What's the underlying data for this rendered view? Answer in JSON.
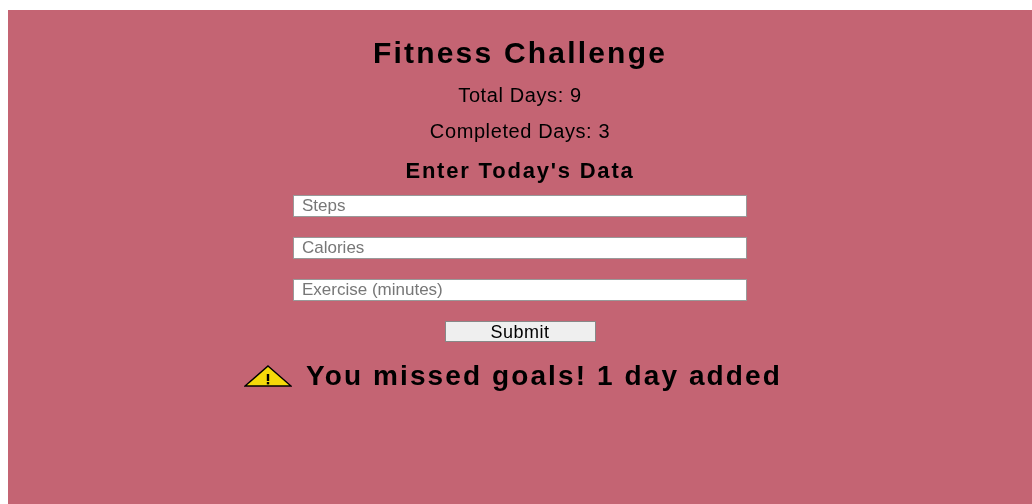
{
  "title": "Fitness Challenge",
  "stats": [
    "Total Days: 9",
    "Completed Days: 3"
  ],
  "form": {
    "heading": "Enter Today's Data",
    "fields": [
      {
        "placeholder": "Steps"
      },
      {
        "placeholder": "Calories"
      },
      {
        "placeholder": "Exercise (minutes)"
      }
    ],
    "submit": "Submit"
  },
  "alert": {
    "kind": "warning",
    "message": "You missed goals! 1 day added"
  }
}
